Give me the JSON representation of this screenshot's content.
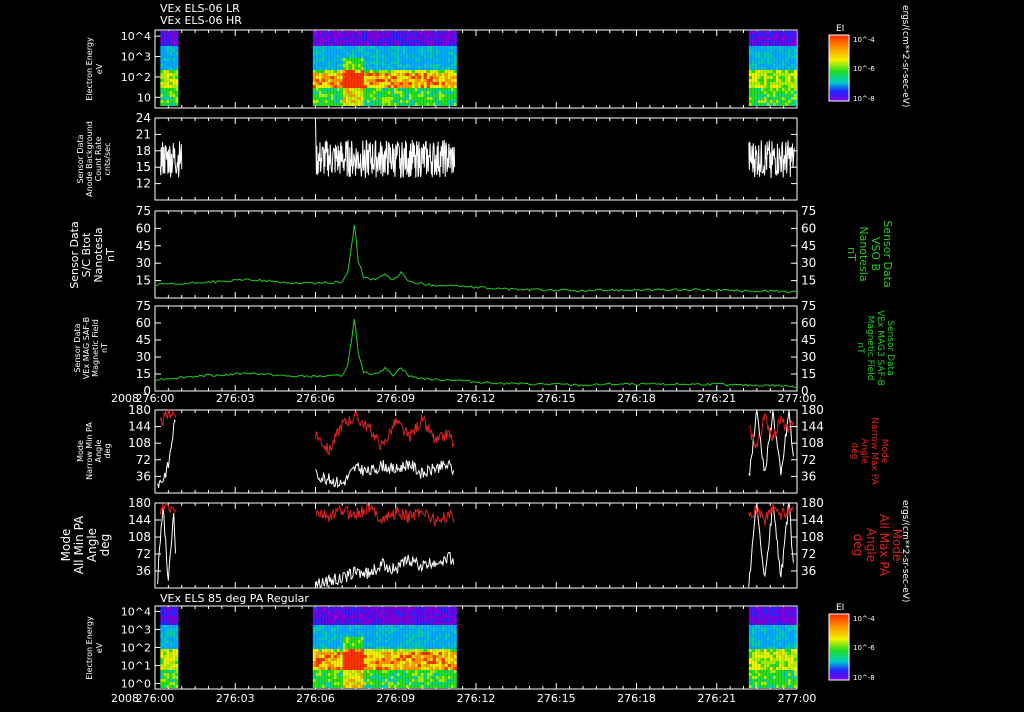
{
  "header": {
    "line1": "VEx ELS-06 LR",
    "line2": "VEx ELS-06 HR"
  },
  "colors": {
    "background": "#000000",
    "axis": "#ffffff",
    "green": "#22cc22",
    "red": "#dd2222",
    "white": "#ffffff"
  },
  "time_axis": {
    "year": "2008",
    "ticks": [
      "276:00",
      "276:03",
      "276:06",
      "276:09",
      "276:12",
      "276:15",
      "276:18",
      "276:21",
      "277:00"
    ]
  },
  "colorbars": {
    "label": "EI",
    "ticks": [
      "10^-4",
      "10^-6",
      "10^-8"
    ],
    "unit": "ergs/(cm**2-sr-sec-eV)"
  },
  "chart_data": [
    {
      "id": "p1",
      "type": "heatmap",
      "title": "VEx ELS-06 LR / HR",
      "ylabel": [
        "Electron Energy",
        "eV"
      ],
      "yticks": [
        "10^4",
        "10^3",
        "10^2",
        "10"
      ],
      "ylim": [
        3,
        20000
      ],
      "scale": "log",
      "xlim": [
        "276:00",
        "277:00"
      ],
      "data_intervals": [
        [
          "276:00.2",
          "276:00.8"
        ],
        [
          "276:05.9",
          "276:11.2"
        ],
        [
          "276:22.2",
          "276:23.9"
        ]
      ]
    },
    {
      "id": "p2",
      "type": "line",
      "ylabel": [
        "Sensor Data",
        "Anode Background",
        "Count Rate",
        "cnts/sec"
      ],
      "yticks": [
        "24",
        "21",
        "18",
        "15",
        "12"
      ],
      "ylim": [
        9,
        24
      ],
      "series": [
        {
          "color": "#ffffff",
          "segments": [
            {
              "x": [
                276.6,
                276.85,
                277.05,
                277.3,
                277.5,
                277.75
              ],
              "base": 16.5,
              "amp": 3.5
            },
            {
              "x": [
                276.06,
                276.11
              ],
              "base": 16.5,
              "amp": 3.5
            },
            {
              "x": [
                276.373,
                276.398
              ],
              "base": 16,
              "amp": 3
            }
          ]
        }
      ]
    },
    {
      "id": "p3",
      "type": "line",
      "ylabel": [
        "Sensor Data",
        "S/C Btot",
        "Nanotesla",
        "nT"
      ],
      "ylabel_right": [
        "Sensor Data",
        "VSO B",
        "Nanotesla",
        "nT"
      ],
      "yticks": [
        "75",
        "60",
        "45",
        "30",
        "15"
      ],
      "ylim": [
        0,
        75
      ],
      "series": [
        {
          "color": "#22cc22",
          "x": [
            0,
            0.5,
            1,
            1.5,
            2,
            2.5,
            3,
            3.5,
            4,
            4.5,
            5,
            5.5,
            6,
            6.5,
            7,
            7.2,
            7.35,
            7.45,
            7.5,
            7.6,
            7.8,
            8.0,
            8.3,
            8.6,
            8.9,
            9.2,
            9.5,
            10,
            10.5,
            11,
            11.5,
            12,
            13,
            14,
            15,
            16,
            17,
            18,
            19,
            20,
            21,
            22,
            23,
            24
          ],
          "y": [
            11,
            12,
            12,
            13,
            14,
            14,
            15,
            16,
            15,
            14,
            13,
            13,
            13,
            13,
            14,
            22,
            45,
            63,
            55,
            32,
            18,
            16,
            17,
            20,
            15,
            22,
            14,
            12,
            11,
            11,
            10,
            9,
            8,
            7,
            7,
            6,
            7,
            7,
            7,
            7,
            7,
            6,
            6,
            5
          ]
        }
      ]
    },
    {
      "id": "p4",
      "type": "line",
      "ylabel": [
        "Sensor Data",
        "VEx MAG SAF-B",
        "Magnetic Field",
        "nT"
      ],
      "ylabel_right": [
        "Sensor Data",
        "VEx MAG3 SAF-B",
        "Magnetic Field",
        "nT"
      ],
      "yticks": [
        "75",
        "60",
        "45",
        "30",
        "15",
        "0"
      ],
      "ylim": [
        0,
        75
      ],
      "series": [
        {
          "color": "#22cc22",
          "x": [
            0,
            0.5,
            1,
            1.5,
            2,
            2.5,
            3,
            3.5,
            4,
            4.5,
            5,
            5.5,
            6,
            6.5,
            7,
            7.2,
            7.35,
            7.45,
            7.5,
            7.6,
            7.8,
            8.0,
            8.3,
            8.6,
            8.9,
            9.2,
            9.5,
            10,
            10.5,
            11,
            11.5,
            12,
            13,
            14,
            15,
            16,
            17,
            18,
            19,
            20,
            21,
            22,
            23,
            24
          ],
          "y": [
            10,
            11,
            12,
            13,
            14,
            14,
            15,
            16,
            15,
            14,
            13,
            13,
            13,
            13,
            14,
            22,
            46,
            63,
            55,
            32,
            17,
            15,
            16,
            20,
            14,
            21,
            13,
            11,
            10,
            10,
            9,
            8,
            7,
            6,
            6,
            5,
            6,
            6,
            6,
            6,
            6,
            5,
            5,
            4
          ]
        }
      ]
    },
    {
      "id": "p5",
      "type": "line",
      "ylabel": [
        "Mode",
        "Narrow Min PA",
        "Angle",
        "deg"
      ],
      "ylabel_right": [
        "Mode",
        "Narrow Max PA",
        "Angle",
        "deg"
      ],
      "yticks": [
        "180",
        "144",
        "108",
        "72",
        "36"
      ],
      "ylim": [
        0,
        180
      ],
      "series": [
        {
          "name": "min",
          "color": "#ffffff",
          "segments": [
            {
              "x": [
                0.1,
                0.3,
                0.5,
                0.7,
                0.8
              ],
              "y": [
                20,
                30,
                60,
                140,
                180
              ]
            },
            {
              "x": [
                6.0,
                6.5,
                7.0,
                7.5,
                8.0,
                8.5,
                9.0,
                9.5,
                10.0,
                10.5,
                11.0,
                11.2
              ],
              "y": [
                40,
                30,
                20,
                55,
                45,
                60,
                50,
                65,
                40,
                55,
                60,
                45
              ]
            },
            {
              "x": [
                22.2,
                22.5,
                22.8,
                23.1,
                23.4,
                23.7,
                23.9
              ],
              "y": [
                30,
                180,
                40,
                180,
                35,
                180,
                50
              ]
            }
          ]
        },
        {
          "name": "max",
          "color": "#dd2222",
          "segments": [
            {
              "x": [
                0.2,
                0.4,
                0.6,
                0.8
              ],
              "y": [
                150,
                165,
                175,
                170
              ]
            },
            {
              "x": [
                6.0,
                6.5,
                7.0,
                7.5,
                8.0,
                8.5,
                9.0,
                9.5,
                10.0,
                10.5,
                11.0,
                11.2
              ],
              "y": [
                130,
                90,
                150,
                165,
                140,
                100,
                155,
                120,
                160,
                110,
                130,
                95
              ]
            },
            {
              "x": [
                22.2,
                22.5,
                22.8,
                23.1,
                23.4,
                23.7,
                23.9
              ],
              "y": [
                140,
                100,
                165,
                120,
                160,
                130,
                170
              ]
            }
          ]
        }
      ]
    },
    {
      "id": "p6",
      "type": "line",
      "ylabel": [
        "Mode",
        "All Min PA",
        "Angle",
        "deg"
      ],
      "ylabel_right": [
        "Mode",
        "All Max PA",
        "Angle",
        "deg"
      ],
      "yticks": [
        "180",
        "144",
        "108",
        "72",
        "36"
      ],
      "ylim": [
        0,
        180
      ],
      "series": [
        {
          "name": "min",
          "color": "#ffffff",
          "segments": [
            {
              "x": [
                0.1,
                0.3,
                0.5,
                0.7,
                0.8
              ],
              "y": [
                20,
                180,
                10,
                170,
                30
              ]
            },
            {
              "x": [
                6.0,
                6.5,
                7.0,
                7.5,
                8.0,
                8.5,
                9.0,
                9.5,
                10.0,
                10.5,
                11.0,
                11.2
              ],
              "y": [
                10,
                15,
                20,
                35,
                30,
                50,
                40,
                60,
                45,
                55,
                65,
                50
              ]
            },
            {
              "x": [
                22.2,
                22.5,
                22.8,
                23.1,
                23.4,
                23.7,
                23.9
              ],
              "y": [
                10,
                180,
                15,
                180,
                20,
                180,
                25
              ]
            }
          ]
        },
        {
          "name": "max",
          "color": "#dd2222",
          "segments": [
            {
              "x": [
                0.2,
                0.4,
                0.6,
                0.8
              ],
              "y": [
                160,
                175,
                165,
                170
              ]
            },
            {
              "x": [
                6.0,
                6.5,
                7.0,
                7.5,
                8.0,
                8.5,
                9.0,
                9.5,
                10.0,
                10.5,
                11.0,
                11.2
              ],
              "y": [
                160,
                150,
                165,
                155,
                170,
                145,
                160,
                150,
                165,
                140,
                155,
                145
              ]
            },
            {
              "x": [
                22.2,
                22.5,
                22.8,
                23.1,
                23.4,
                23.7,
                23.9
              ],
              "y": [
                150,
                170,
                145,
                175,
                155,
                165,
                170
              ]
            }
          ]
        }
      ]
    },
    {
      "id": "p7",
      "type": "heatmap",
      "title": "VEx ELS 85 deg PA Regular",
      "ylabel": [
        "Electron Energy",
        "eV"
      ],
      "yticks": [
        "10^4",
        "10^3",
        "10^2",
        "10^1",
        "10^0"
      ],
      "ylim": [
        0.5,
        20000
      ],
      "scale": "log",
      "xlim": [
        "276:00",
        "277:00"
      ],
      "data_intervals": [
        [
          "276:00.2",
          "276:00.8"
        ],
        [
          "276:05.9",
          "276:11.2"
        ],
        [
          "276:22.2",
          "276:23.9"
        ]
      ]
    }
  ]
}
